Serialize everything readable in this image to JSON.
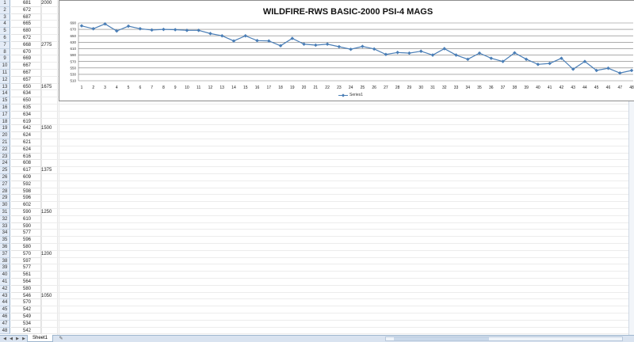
{
  "sheet": {
    "row_numbers": [
      "1",
      "2",
      "3",
      "4",
      "5",
      "6",
      "7",
      "8",
      "9",
      "10",
      "11",
      "12",
      "13",
      "14",
      "15",
      "16",
      "17",
      "18",
      "19",
      "20",
      "21",
      "22",
      "23",
      "24",
      "25",
      "26",
      "27",
      "28",
      "29",
      "30",
      "31",
      "32",
      "33",
      "34",
      "35",
      "36",
      "37",
      "38",
      "39",
      "40",
      "41",
      "42",
      "43",
      "44",
      "45",
      "46",
      "47",
      "48"
    ],
    "col_a_values": [
      "681",
      "672",
      "687",
      "665",
      "680",
      "672",
      "668",
      "670",
      "669",
      "667",
      "667",
      "657",
      "650",
      "634",
      "650",
      "635",
      "634",
      "619",
      "642",
      "624",
      "621",
      "624",
      "616",
      "608",
      "617",
      "609",
      "592",
      "598",
      "596",
      "602",
      "590",
      "610",
      "590",
      "577",
      "596",
      "580",
      "570",
      "597",
      "577",
      "561",
      "564",
      "580",
      "546",
      "570",
      "542",
      "549",
      "534",
      "542"
    ],
    "col_b_axis": [
      {
        "row": 1,
        "label": "2000"
      },
      {
        "row": 7,
        "label": "2775"
      },
      {
        "row": 13,
        "label": "1675"
      },
      {
        "row": 19,
        "label": "1500"
      },
      {
        "row": 25,
        "label": "1375"
      },
      {
        "row": 31,
        "label": "1250"
      },
      {
        "row": 37,
        "label": "1200"
      },
      {
        "row": 43,
        "label": "1050"
      }
    ]
  },
  "tabs": {
    "sheet1_label": "Sheet1"
  },
  "chart_data": {
    "type": "line",
    "title": "WILDFIRE-RWS BASIC-2000 PSI-4 MAGS",
    "xlabel": "",
    "ylabel": "",
    "categories": [
      1,
      2,
      3,
      4,
      5,
      6,
      7,
      8,
      9,
      10,
      11,
      12,
      13,
      14,
      15,
      16,
      17,
      18,
      19,
      20,
      21,
      22,
      23,
      24,
      25,
      26,
      27,
      28,
      29,
      30,
      31,
      32,
      33,
      34,
      35,
      36,
      37,
      38,
      39,
      40,
      41,
      42,
      43,
      44,
      45,
      46,
      47,
      48
    ],
    "y_tick_labels": [
      "510",
      "530",
      "550",
      "570",
      "590",
      "610",
      "630",
      "650",
      "670",
      "690"
    ],
    "ylim": [
      510,
      690
    ],
    "legend": "bottom",
    "grid": true,
    "series": [
      {
        "name": "Series1",
        "color": "#4a7eb6",
        "values": [
          681,
          672,
          687,
          665,
          680,
          672,
          668,
          670,
          669,
          667,
          667,
          657,
          650,
          634,
          650,
          635,
          634,
          619,
          642,
          624,
          621,
          624,
          616,
          608,
          617,
          609,
          592,
          598,
          596,
          602,
          590,
          610,
          590,
          577,
          596,
          580,
          570,
          597,
          577,
          561,
          564,
          580,
          546,
          570,
          542,
          549,
          534,
          542
        ]
      }
    ]
  }
}
